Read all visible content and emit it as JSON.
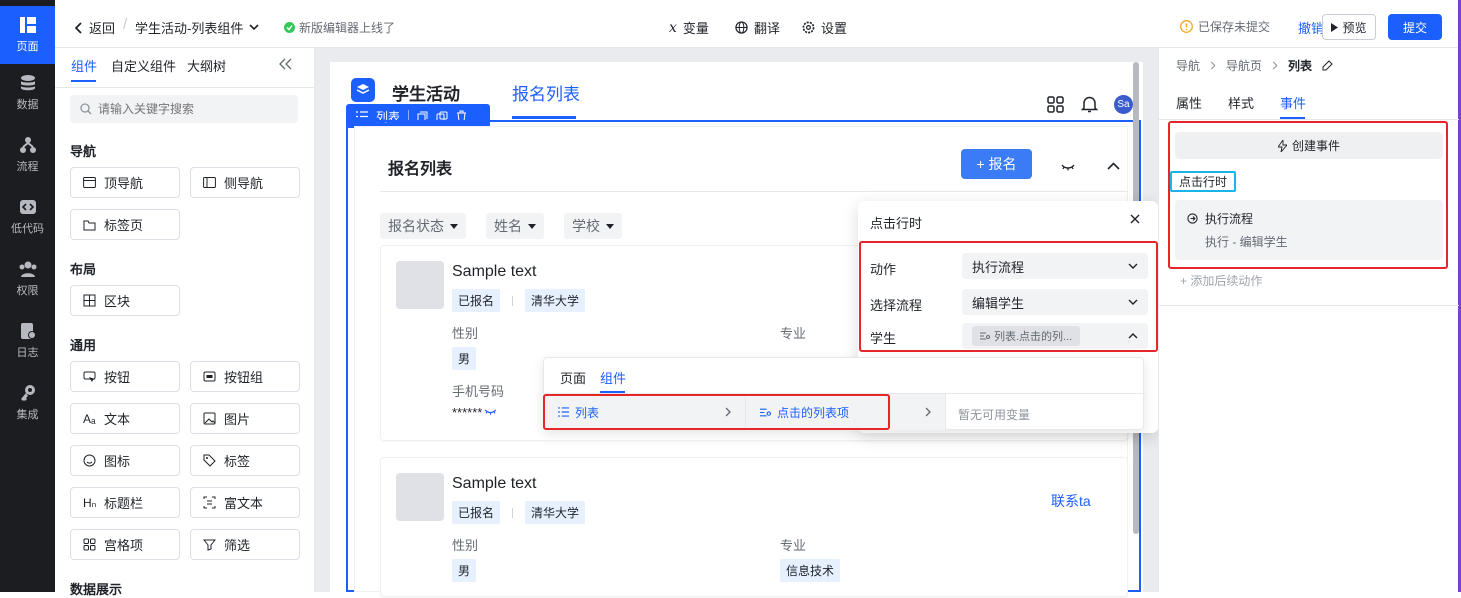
{
  "rail": [
    {
      "label": "页面",
      "icon": "pages-icon"
    },
    {
      "label": "数据",
      "icon": "database-icon"
    },
    {
      "label": "流程",
      "icon": "flow-icon"
    },
    {
      "label": "低代码",
      "icon": "code-icon"
    },
    {
      "label": "权限",
      "icon": "users-icon"
    },
    {
      "label": "日志",
      "icon": "log-icon"
    },
    {
      "label": "集成",
      "icon": "key-icon"
    }
  ],
  "topbar": {
    "back": "返回",
    "app_title": "学生活动-列表组件",
    "notice": "新版编辑器上线了",
    "variables": "变量",
    "translate": "翻译",
    "settings": "设置",
    "save_status": "已保存未提交",
    "undo": "撤销",
    "preview": "预览",
    "submit": "提交"
  },
  "left": {
    "tabs": [
      "组件",
      "自定义组件",
      "大纲树"
    ],
    "search_placeholder": "请输入关键字搜索",
    "sections": {
      "nav": "导航",
      "layout": "布局",
      "common": "通用",
      "data": "数据展示"
    },
    "items": {
      "top_nav": "顶导航",
      "side_nav": "侧导航",
      "tabs": "标签页",
      "block": "区块",
      "button": "按钮",
      "button_group": "按钮组",
      "text": "文本",
      "image": "图片",
      "icon": "图标",
      "tag": "标签",
      "title_bar": "标题栏",
      "rich_text": "富文本",
      "grid": "宫格项",
      "filter": "筛选"
    }
  },
  "canvas": {
    "app_name": "学生活动",
    "nav_tab": "报名列表",
    "avatar": "Sa",
    "toolbar_label": "列表",
    "list_title": "报名列表",
    "signup_btn": "+ 报名",
    "filters": [
      "报名状态",
      "姓名",
      "学校"
    ],
    "cards": [
      {
        "title": "Sample text",
        "status": "已报名",
        "school": "清华大学",
        "gender_label": "性别",
        "gender": "男",
        "major_label": "专业",
        "phone_label": "手机号码",
        "phone": "******"
      },
      {
        "title": "Sample text",
        "status": "已报名",
        "school": "清华大学",
        "gender_label": "性别",
        "gender": "男",
        "major_label": "专业",
        "major": "信息技术",
        "contact": "联系ta"
      }
    ]
  },
  "popover": {
    "title": "点击行时",
    "action_label": "动作",
    "action_value": "执行流程",
    "flow_label": "选择流程",
    "flow_value": "编辑学生",
    "student_label": "学生",
    "student_value": "列表.点击的列..."
  },
  "var_picker": {
    "tabs": [
      "页面",
      "组件"
    ],
    "col1": "列表",
    "col2": "点击的列表项",
    "col4": "暂无可用变量"
  },
  "right": {
    "breadcrumb": [
      "导航",
      "导航页",
      "列表"
    ],
    "tabs": [
      "属性",
      "样式",
      "事件"
    ],
    "create_event": "创建事件",
    "event_name": "点击行时",
    "action_title": "执行流程",
    "action_desc": "执行 - 编辑学生",
    "add_followup": "+ 添加后续动作"
  },
  "colors": {
    "primary": "#1b5fff",
    "danger": "#e5262b",
    "rail": "#1c1d21",
    "highlight_cyan": "#19b5e8"
  }
}
